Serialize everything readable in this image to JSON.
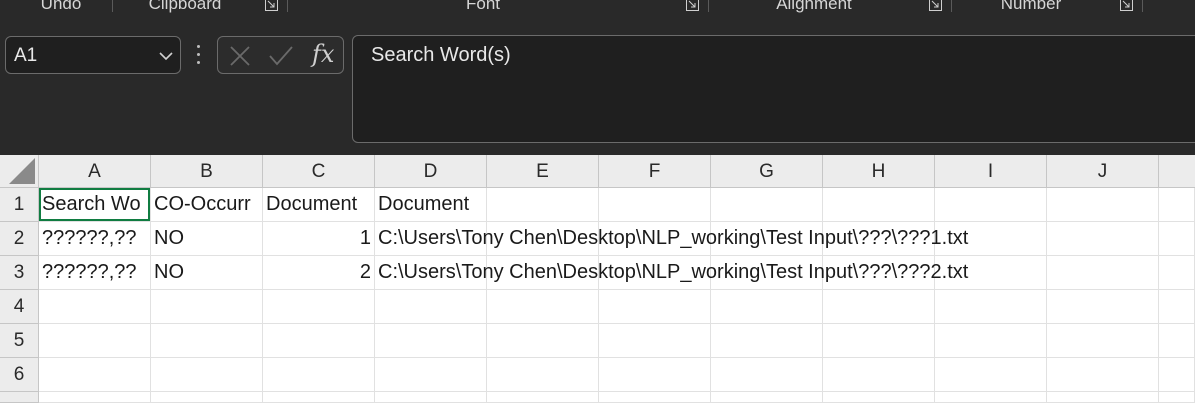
{
  "ribbon": {
    "groups": [
      {
        "label": "Undo"
      },
      {
        "label": "Clipboard"
      },
      {
        "label": "Font"
      },
      {
        "label": "Alignment"
      },
      {
        "label": "Number"
      }
    ]
  },
  "formula_bar": {
    "name_box": "A1",
    "fx": "fx",
    "content": "Search Word(s)"
  },
  "sheet": {
    "columns": [
      "A",
      "B",
      "C",
      "D",
      "E",
      "F",
      "G",
      "H",
      "I",
      "J"
    ],
    "rows": [
      "1",
      "2",
      "3",
      "4",
      "5",
      "6"
    ],
    "cells": {
      "A1": "Search Wo",
      "B1": "CO-Occurr",
      "C1": "Document",
      "D1": "Document",
      "A2": "??????,??",
      "B2": "NO",
      "C2": "1",
      "D2": "C:\\Users\\Tony Chen\\Desktop\\NLP_working\\Test Input\\???\\???1.txt",
      "A3": "??????,??",
      "B3": "NO",
      "C3": "2",
      "D3": "C:\\Users\\Tony Chen\\Desktop\\NLP_working\\Test Input\\???\\???2.txt"
    }
  },
  "colors": {
    "accent": "#107c41",
    "chrome_bg": "#292929",
    "header_bg": "#ececec"
  }
}
